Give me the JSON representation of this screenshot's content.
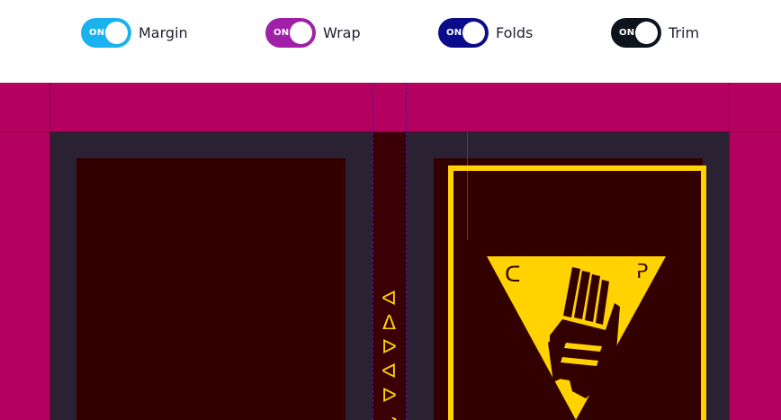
{
  "toggles": [
    {
      "label": "Margin",
      "state": "ON",
      "color": "#1ab2ee"
    },
    {
      "label": "Wrap",
      "state": "ON",
      "color": "#a020a8"
    },
    {
      "label": "Folds",
      "state": "ON",
      "color": "#0b0c8a"
    },
    {
      "label": "Trim",
      "state": "ON",
      "color": "#0e141d"
    }
  ],
  "cover": {
    "spine_title": "ᐊᐃᐅᐊᐅᓗᒍᕕᕈ",
    "colors": {
      "wrap": "#b4005f",
      "board": "#2a2233",
      "panel": "#330000",
      "accent": "#ffd200"
    },
    "emblem_icon": "raised-fist-triangle-icon"
  }
}
